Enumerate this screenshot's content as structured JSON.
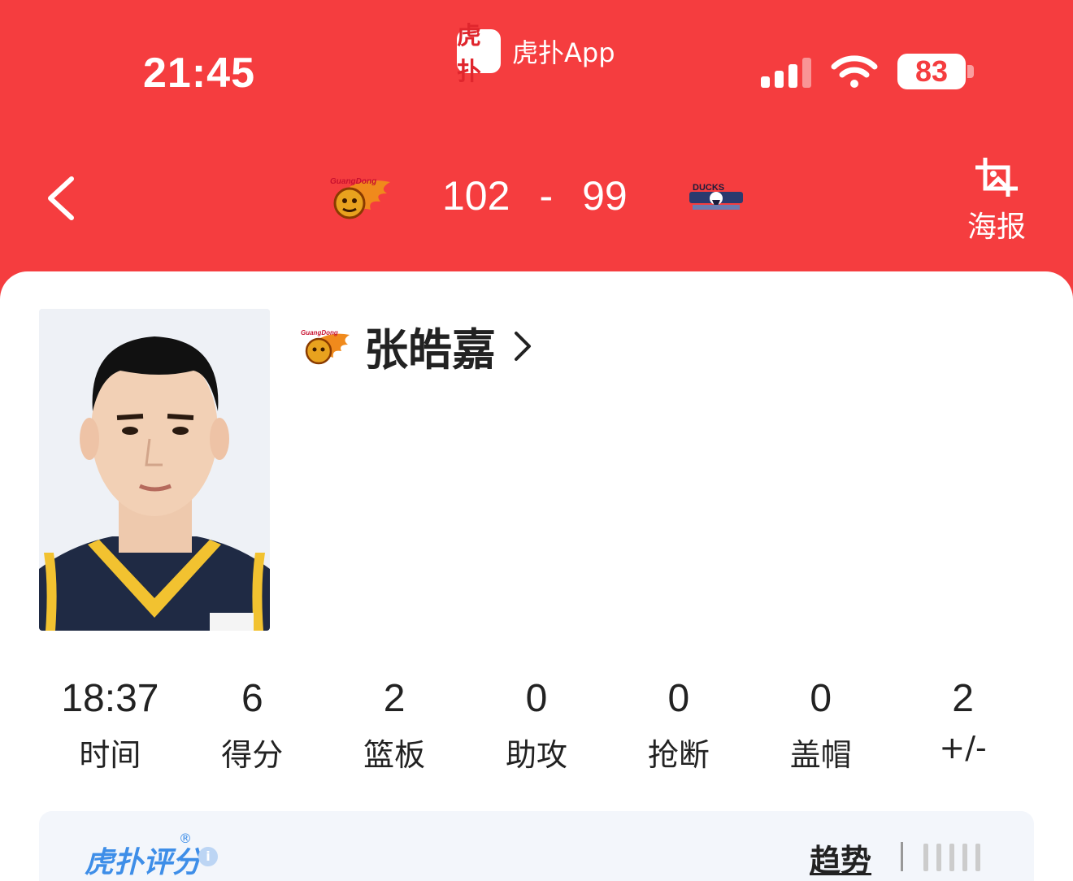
{
  "status_bar": {
    "time": "21:45",
    "app_name": "虎扑App",
    "app_logo_text": "虎扑",
    "battery": "83",
    "icons": [
      "cellular-signal-icon",
      "wifi-icon",
      "battery-icon"
    ]
  },
  "game": {
    "home_score": "102",
    "separator": "-",
    "away_score": "99",
    "poster_label": "海报",
    "home_logo": "guangdong-tigers-logo",
    "away_logo": "ducks-logo"
  },
  "player": {
    "name": "张皓嘉",
    "team_logo": "guangdong-tigers-logo"
  },
  "stats": [
    {
      "value": "18:37",
      "label": "时间"
    },
    {
      "value": "6",
      "label": "得分"
    },
    {
      "value": "2",
      "label": "篮板"
    },
    {
      "value": "0",
      "label": "助攻"
    },
    {
      "value": "0",
      "label": "抢断"
    },
    {
      "value": "0",
      "label": "盖帽"
    },
    {
      "value": "2",
      "label": "+/-"
    }
  ],
  "rating": {
    "title": "虎扑评分",
    "registered": "®",
    "info": "i",
    "trend_label": "趋势"
  },
  "colors": {
    "brand_red": "#f53d3f",
    "accent_blue": "#3e8ee8"
  }
}
